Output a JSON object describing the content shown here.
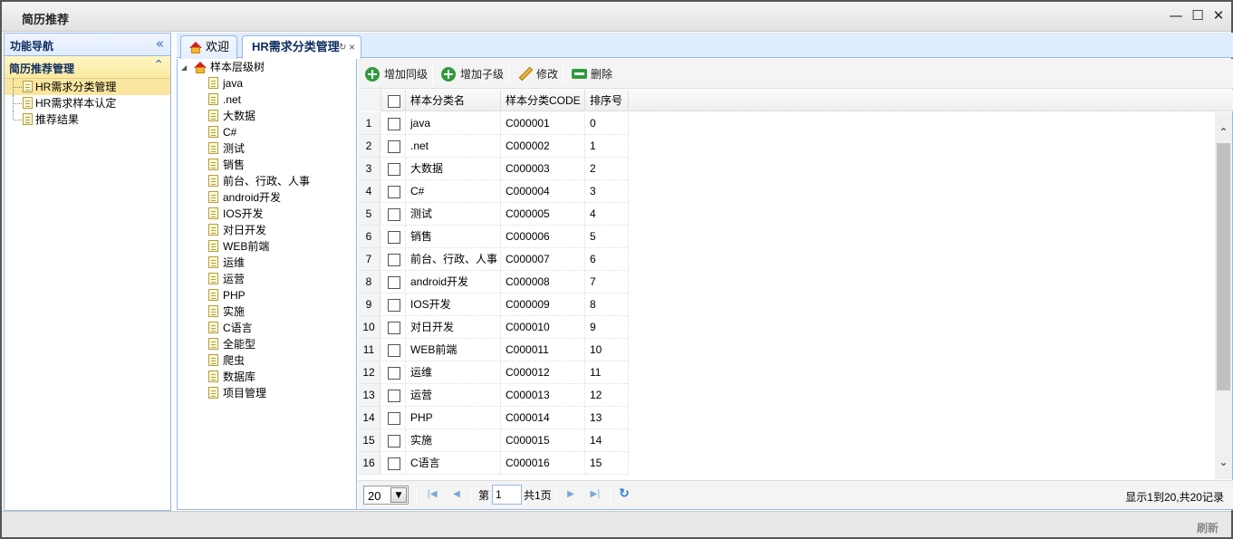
{
  "window": {
    "title": "简历推荐",
    "minimize_glyph": "—",
    "maximize_glyph": "☐",
    "close_glyph": "✕"
  },
  "nav": {
    "header": "功能导航",
    "collapse_glyph": "«",
    "section_title": "简历推荐管理",
    "section_glyph": "⌃",
    "items": [
      {
        "label": "HR需求分类管理",
        "selected": true
      },
      {
        "label": "HR需求样本认定",
        "selected": false
      },
      {
        "label": "推荐结果",
        "selected": false
      }
    ]
  },
  "tabs": [
    {
      "label": "欢迎",
      "icon": "home-icon",
      "active": false
    },
    {
      "label": "HR需求分类管理",
      "active": true,
      "refresh_glyph": "↻",
      "close_glyph": "×"
    }
  ],
  "tree": {
    "root_label": "样本层级树",
    "expand_glyph": "◢",
    "leaves": [
      "java",
      ".net",
      "大数据",
      "C#",
      "测试",
      "销售",
      "前台、行政、人事",
      "android开发",
      "IOS开发",
      "对日开发",
      "WEB前端",
      "运维",
      "运营",
      "PHP",
      "实施",
      "C语言",
      "全能型",
      "爬虫",
      "数据库",
      "项目管理"
    ]
  },
  "toolbar": {
    "add_sibling": "增加同级",
    "add_child": "增加子级",
    "edit": "修改",
    "delete": "删除"
  },
  "grid": {
    "columns": [
      "样本分类名",
      "样本分类CODE",
      "排序号"
    ],
    "rows": [
      {
        "n": "1",
        "name": "java",
        "code": "C000001",
        "order": "0"
      },
      {
        "n": "2",
        "name": ".net",
        "code": "C000002",
        "order": "1"
      },
      {
        "n": "3",
        "name": "大数据",
        "code": "C000003",
        "order": "2"
      },
      {
        "n": "4",
        "name": "C#",
        "code": "C000004",
        "order": "3"
      },
      {
        "n": "5",
        "name": "测试",
        "code": "C000005",
        "order": "4"
      },
      {
        "n": "6",
        "name": "销售",
        "code": "C000006",
        "order": "5"
      },
      {
        "n": "7",
        "name": "前台、行政、人事",
        "code": "C000007",
        "order": "6"
      },
      {
        "n": "8",
        "name": "android开发",
        "code": "C000008",
        "order": "7"
      },
      {
        "n": "9",
        "name": "IOS开发",
        "code": "C000009",
        "order": "8"
      },
      {
        "n": "10",
        "name": "对日开发",
        "code": "C000010",
        "order": "9"
      },
      {
        "n": "11",
        "name": "WEB前端",
        "code": "C000011",
        "order": "10"
      },
      {
        "n": "12",
        "name": "运维",
        "code": "C000012",
        "order": "11"
      },
      {
        "n": "13",
        "name": "运营",
        "code": "C000013",
        "order": "12"
      },
      {
        "n": "14",
        "name": "PHP",
        "code": "C000014",
        "order": "13"
      },
      {
        "n": "15",
        "name": "实施",
        "code": "C000015",
        "order": "14"
      },
      {
        "n": "16",
        "name": "C语言",
        "code": "C000016",
        "order": "15"
      }
    ]
  },
  "pager": {
    "page_size": "20",
    "page_prefix": "第",
    "page_value": "1",
    "page_total": "共1页",
    "info": "显示1到20,共20记录"
  },
  "footer": {
    "refresh": "刷新"
  },
  "colors": {
    "panel_border": "#95b8e7",
    "selected_row": "#fbe6a0",
    "accent_green": "#2f9a3c"
  }
}
